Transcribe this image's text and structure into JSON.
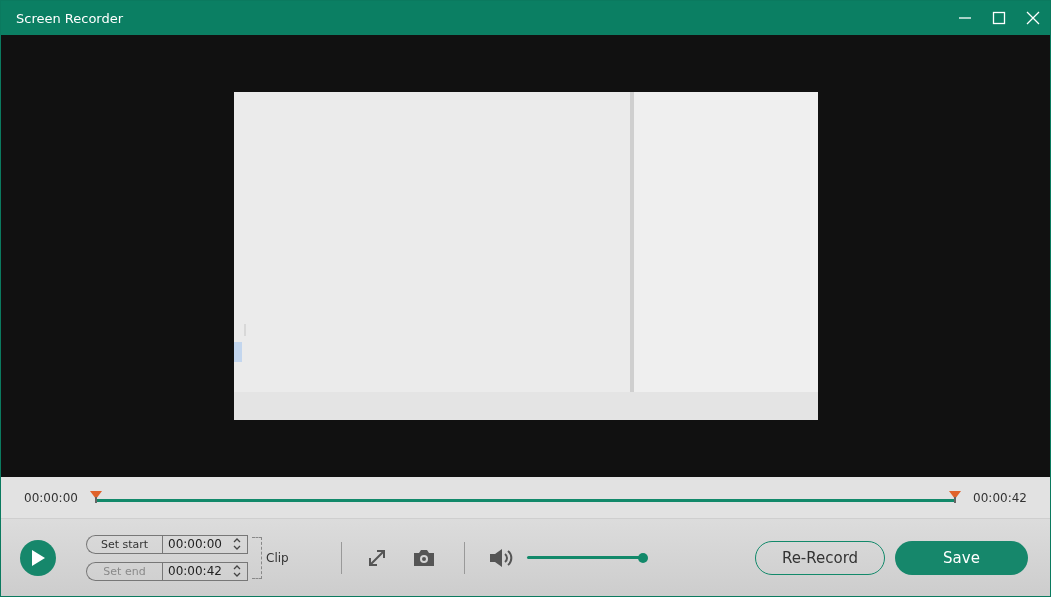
{
  "window": {
    "title": "Screen Recorder"
  },
  "timeline": {
    "start_time": "00:00:00",
    "end_time": "00:00:42",
    "level": 0
  },
  "clip": {
    "set_start": {
      "label": "Set start",
      "value": "00:00:00",
      "disabled": false
    },
    "set_end": {
      "label": "Set end",
      "value": "00:00:42",
      "disabled": true
    },
    "label": "Clip"
  },
  "volume": {
    "level": 1
  },
  "buttons": [
    {
      "label": "Re-Record",
      "kind": "outline"
    },
    {
      "label": "Save",
      "kind": "primary"
    }
  ]
}
